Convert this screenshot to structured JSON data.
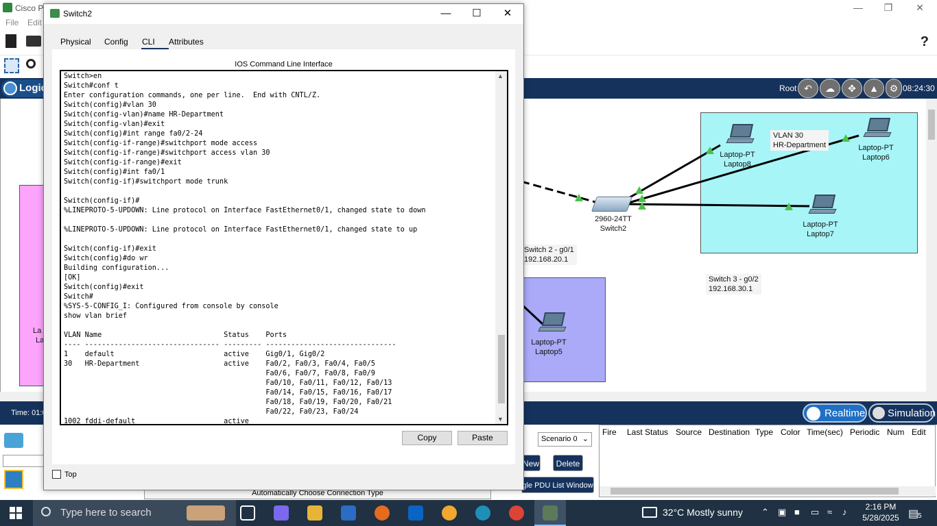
{
  "app": {
    "title": "Cisco Packet Tracer",
    "menu": [
      "File",
      "Edit"
    ],
    "help_icon": "?",
    "logical_tab": "Logical",
    "root_label": "Root",
    "time_top": "08:24:30",
    "time_label": "Time: 01:0",
    "realtime": "Realtime",
    "simulation": "Simulation",
    "scenario": "Scenario 0",
    "new_button": "New",
    "delete_button": "Delete",
    "pdu_list_button": "gle PDU List Window",
    "auto_connection": "Automatically Choose Connection Type",
    "pdu_columns": [
      "Fire",
      "Last Status",
      "Source",
      "Destination",
      "Type",
      "Color",
      "Time(sec)",
      "Periodic",
      "Num",
      "Edit"
    ]
  },
  "canvas": {
    "switch_model": "2960-24TT",
    "switch_name": "Switch2",
    "vlan_note": [
      "VLAN 30",
      "HR-Department"
    ],
    "switch2_note": [
      "Switch 2 - g0/1",
      "192.168.20.1"
    ],
    "switch3_note": [
      "Switch 3 - g0/2",
      "192.168.30.1"
    ],
    "laptops": [
      {
        "model": "Laptop-PT",
        "name": "Laptop8"
      },
      {
        "model": "Laptop-PT",
        "name": "Laptop6"
      },
      {
        "model": "Laptop-PT",
        "name": "Laptop7"
      },
      {
        "model": "Laptop-PT",
        "name": "Laptop5"
      }
    ],
    "pink_labels": [
      "La",
      "La"
    ]
  },
  "dialog": {
    "title": "Switch2",
    "tabs": [
      "Physical",
      "Config",
      "CLI",
      "Attributes"
    ],
    "active_tab": "CLI",
    "heading": "IOS Command Line Interface",
    "copy_button": "Copy",
    "paste_button": "Paste",
    "top_checkbox": "Top",
    "top_checked": false,
    "cli_lines": [
      "Switch>en",
      "Switch#conf t",
      "Enter configuration commands, one per line.  End with CNTL/Z.",
      "Switch(config)#vlan 30",
      "Switch(config-vlan)#name HR-Department",
      "Switch(config-vlan)#exit",
      "Switch(config)#int range fa0/2-24",
      "Switch(config-if-range)#switchport mode access",
      "Switch(config-if-range)#switchport access vlan 30",
      "Switch(config-if-range)#exit",
      "Switch(config)#int fa0/1",
      "Switch(config-if)#switchport mode trunk",
      "",
      "Switch(config-if)#",
      "%LINEPROTO-5-UPDOWN: Line protocol on Interface FastEthernet0/1, changed state to down",
      "",
      "%LINEPROTO-5-UPDOWN: Line protocol on Interface FastEthernet0/1, changed state to up",
      "",
      "Switch(config-if)#exit",
      "Switch(config)#do wr",
      "Building configuration...",
      "[OK]",
      "Switch(config)#exit",
      "Switch#",
      "%SYS-5-CONFIG_I: Configured from console by console",
      "show vlan brief",
      "",
      "VLAN Name                             Status    Ports",
      "---- -------------------------------- --------- -------------------------------",
      "1    default                          active    Gig0/1, Gig0/2",
      "30   HR-Department                    active    Fa0/2, Fa0/3, Fa0/4, Fa0/5",
      "                                                Fa0/6, Fa0/7, Fa0/8, Fa0/9",
      "                                                Fa0/10, Fa0/11, Fa0/12, Fa0/13",
      "                                                Fa0/14, Fa0/15, Fa0/16, Fa0/17",
      "                                                Fa0/18, Fa0/19, Fa0/20, Fa0/21",
      "                                                Fa0/22, Fa0/23, Fa0/24",
      "1002 fddi-default                     active"
    ]
  },
  "taskbar": {
    "search_placeholder": "Type here to search",
    "weather": "32°C  Mostly sunny",
    "time": "2:16 PM",
    "date": "5/28/2025",
    "notification_count": "5"
  }
}
